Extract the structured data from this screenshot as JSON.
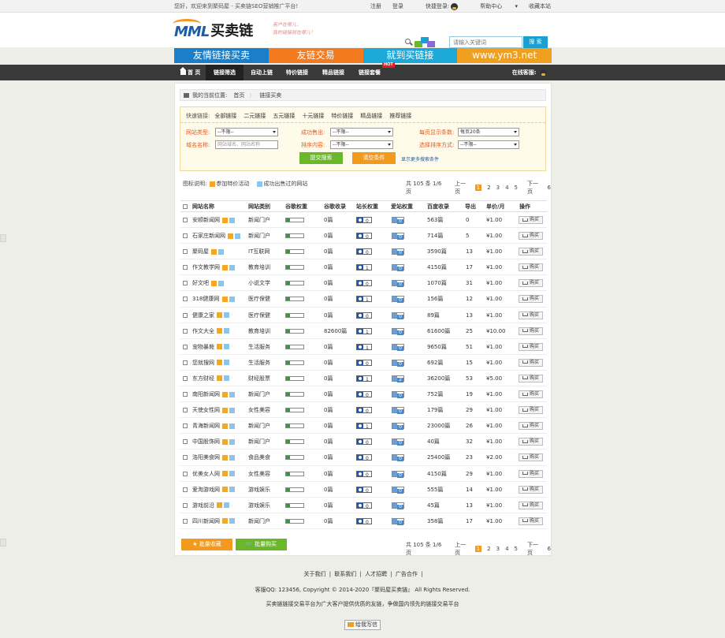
{
  "topbar": {
    "welcome": "您好，欢迎来到聚码屋 - 买卖链SEO营销推广平台!",
    "register": "注册",
    "login": "登录",
    "quick_login": "快捷登录:",
    "help": "帮助中心",
    "favorite": "收藏本站"
  },
  "header": {
    "logo_letters": "MML",
    "logo_cn": "买卖链",
    "slogan_1": "客户在哪儿，",
    "slogan_2": "我的链接就在哪儿！",
    "search_placeholder": "请输入关键词",
    "search_button": "搜 索"
  },
  "banners": [
    {
      "label": "友情链接买卖",
      "color": "#1a7fc8"
    },
    {
      "label": "友链交易",
      "color": "#f47a1e"
    },
    {
      "label": "就到买链接",
      "color": "#1ca9d8"
    },
    {
      "label": "www.ym3.net",
      "color": "#f0a020"
    }
  ],
  "nav": {
    "items": [
      "首 页",
      "链接筛选",
      "自动上链",
      "特价链接",
      "精品链接",
      "链接套餐"
    ],
    "hot_badge": "HOT",
    "service": "在线客服:"
  },
  "breadcrumb": {
    "prefix": "我的当前位置:",
    "home": "首页",
    "current": "链接买卖"
  },
  "filter": {
    "quick_label": "快速链接:",
    "quick": [
      "全部链接",
      "二元链接",
      "五元链接",
      "十元链接",
      "特价链接",
      "精品链接",
      "推荐链接"
    ],
    "site_type_label": "网站类型:",
    "site_type_value": "--不限--",
    "success_label": "成功售出:",
    "success_value": "--不限--",
    "per_page_label": "每页显示条数:",
    "per_page_value": "每页20条",
    "domain_label": "域名名称:",
    "domain_placeholder": "网站域名、网站名称",
    "sort_label": "排序内容:",
    "sort_value": "--不限--",
    "sort_method_label": "选择排序方式:",
    "sort_method_value": "--不限--",
    "submit": "提交搜索",
    "clear": "清空条件",
    "more": "显示更多搜索条件"
  },
  "legend": {
    "label": "图标说明:",
    "special": "参加特价活动",
    "sold": "成功出售过的网站"
  },
  "pager": {
    "summary": "共 105 条 1/6 页",
    "prev": "上一页",
    "pages": [
      "1",
      "2",
      "3",
      "4",
      "5"
    ],
    "next": "下一页",
    "last": "6"
  },
  "table": {
    "headers": [
      "网站名称",
      "网站类别",
      "谷歌权重",
      "谷歌收录",
      "站长权重",
      "爱站权重",
      "百度收录",
      "导出",
      "单价/月",
      "操作"
    ],
    "buy_label": "购买",
    "rows": [
      {
        "name": "安顺新闻网",
        "cat": "新闻门户",
        "g": "0篇",
        "zz": "0",
        "az": "0",
        "bd": "563篇",
        "out": "0",
        "price": "¥1.00"
      },
      {
        "name": "石家庄新闻网",
        "cat": "新闻门户",
        "g": "0篇",
        "zz": "0",
        "az": "0",
        "bd": "714篇",
        "out": "5",
        "price": "¥1.00"
      },
      {
        "name": "聚码屋",
        "cat": "IT互联网",
        "g": "0篇",
        "zz": "0",
        "az": "0",
        "bd": "3590篇",
        "out": "13",
        "price": "¥1.00"
      },
      {
        "name": "作文教学网",
        "cat": "教育培训",
        "g": "0篇",
        "zz": "1",
        "az": "0",
        "bd": "4150篇",
        "out": "17",
        "price": "¥1.00"
      },
      {
        "name": "好文吧",
        "cat": "小说文学",
        "g": "0篇",
        "zz": "0",
        "az": "0",
        "bd": "1070篇",
        "out": "31",
        "price": "¥1.00"
      },
      {
        "name": "318健康网",
        "cat": "医疗保健",
        "g": "0篇",
        "zz": "1",
        "az": "0",
        "bd": "156篇",
        "out": "12",
        "price": "¥1.00"
      },
      {
        "name": "健康之家",
        "cat": "医疗保健",
        "g": "0篇",
        "zz": "0",
        "az": "0",
        "bd": "89篇",
        "out": "13",
        "price": "¥1.00"
      },
      {
        "name": "作文大全",
        "cat": "教育培训",
        "g": "82600篇",
        "zz": "1",
        "az": "0",
        "bd": "61600篇",
        "out": "25",
        "price": "¥10.00"
      },
      {
        "name": "宠物暴毙",
        "cat": "生活服务",
        "g": "0篇",
        "zz": "1",
        "az": "0",
        "bd": "9650篇",
        "out": "51",
        "price": "¥1.00"
      },
      {
        "name": "您就搜网",
        "cat": "生活服务",
        "g": "0篇",
        "zz": "0",
        "az": "0",
        "bd": "692篇",
        "out": "15",
        "price": "¥1.00"
      },
      {
        "name": "东方财经",
        "cat": "财经股票",
        "g": "0篇",
        "zz": "1",
        "az": "2",
        "bd": "36200篇",
        "out": "53",
        "price": "¥5.00"
      },
      {
        "name": "南阳新闻网",
        "cat": "新闻门户",
        "g": "0篇",
        "zz": "0",
        "az": "0",
        "bd": "752篇",
        "out": "19",
        "price": "¥1.00"
      },
      {
        "name": "天使女性网",
        "cat": "女性美容",
        "g": "0篇",
        "zz": "0",
        "az": "0",
        "bd": "179篇",
        "out": "29",
        "price": "¥1.00"
      },
      {
        "name": "青海新闻网",
        "cat": "新闻门户",
        "g": "0篇",
        "zz": "1",
        "az": "0",
        "bd": "23000篇",
        "out": "26",
        "price": "¥1.00"
      },
      {
        "name": "中国股饰网",
        "cat": "新闻门户",
        "g": "0篇",
        "zz": "0",
        "az": "0",
        "bd": "40篇",
        "out": "32",
        "price": "¥1.00"
      },
      {
        "name": "洛阳美食网",
        "cat": "食品美食",
        "g": "0篇",
        "zz": "0",
        "az": "0",
        "bd": "25400篇",
        "out": "23",
        "price": "¥2.00"
      },
      {
        "name": "优美女人网",
        "cat": "女性美容",
        "g": "0篇",
        "zz": "0",
        "az": "0",
        "bd": "4150篇",
        "out": "29",
        "price": "¥1.00"
      },
      {
        "name": "爱淘游戏网",
        "cat": "游戏娱乐",
        "g": "0篇",
        "zz": "0",
        "az": "0",
        "bd": "555篇",
        "out": "14",
        "price": "¥1.00"
      },
      {
        "name": "游戏前沿",
        "cat": "游戏娱乐",
        "g": "0篇",
        "zz": "0",
        "az": "0",
        "bd": "45篇",
        "out": "13",
        "price": "¥1.00"
      },
      {
        "name": "四川新闻网",
        "cat": "新闻门户",
        "g": "0篇",
        "zz": "0",
        "az": "0",
        "bd": "358篇",
        "out": "17",
        "price": "¥1.00"
      }
    ]
  },
  "bottom": {
    "fav": "批量收藏",
    "buy": "批量购买"
  },
  "footer": {
    "links": [
      "关于我们",
      "联系我们",
      "人才招聘",
      "广告合作"
    ],
    "copyright": "客服QQ:  123456,  Copyright © 2014-2020『聚码屋买卖链』 All Rights Reserved.",
    "desc": "买卖链链接交易平台为广大客户提供优质的友链，争做国内领先的链接交易平台",
    "chat": "给我写信"
  }
}
